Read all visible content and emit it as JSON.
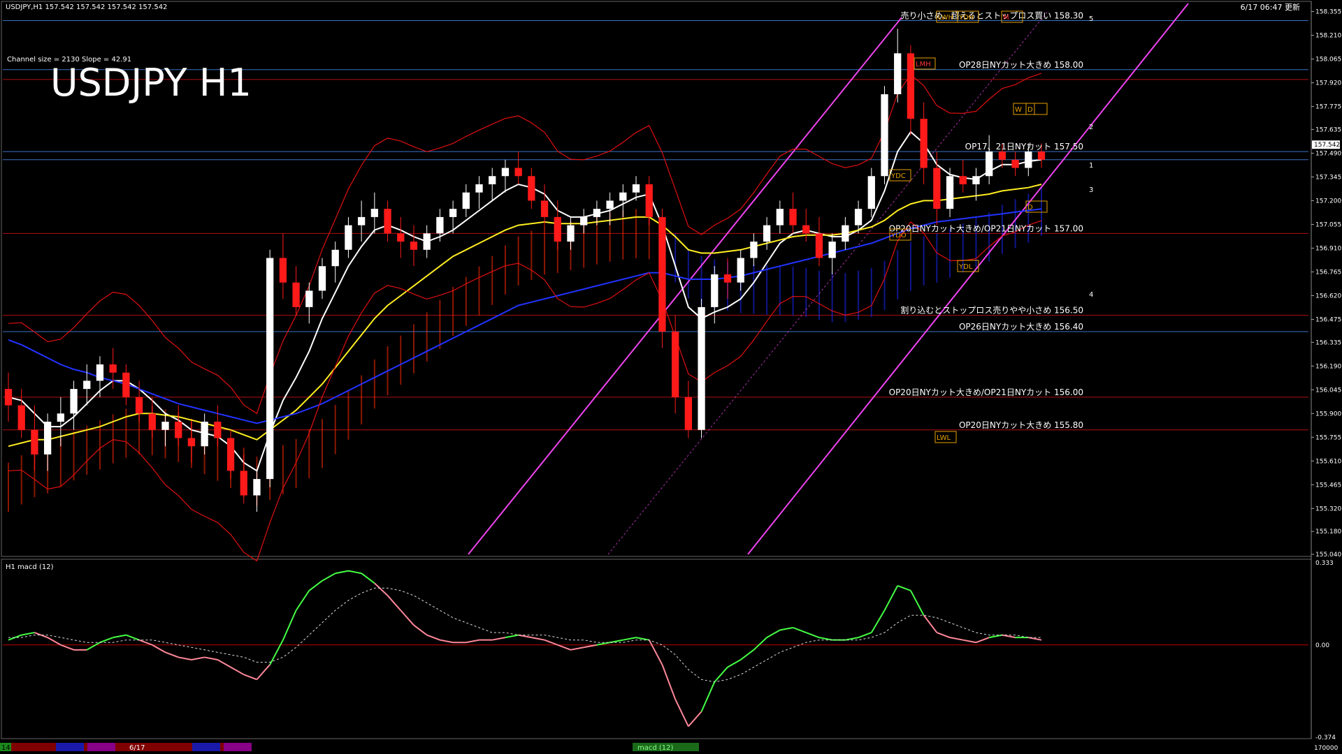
{
  "header": {
    "symbol_info": "USDJPY,H1  157.542 157.542 157.542 157.542",
    "datetime": "6/17 06:47 更新"
  },
  "channel_info": "Channel size = 2130 Slope = 42.91",
  "big_title": "USDJPY H1",
  "macd_label": "H1  macd (12)",
  "colors": {
    "background": "#000000",
    "grid_blue": "#3a74c4",
    "grid_red": "#b01010",
    "candle_up": "#ffffff",
    "candle_down": "#ff1a1a",
    "ma_white": "#ffffff",
    "ma_yellow": "#ffee22",
    "ma_blue": "#2233ff",
    "bollinger": "#e01010",
    "green_line": "#22cc22",
    "channel": "#ee44ee",
    "cloud_red": "#ff2a00",
    "cloud_blue": "#1a2aff",
    "macd_green": "#44ff44",
    "macd_pink": "#ff8899",
    "price_box": "#ffffff"
  },
  "annotations": [
    {
      "text": "売り小さめ、超えるとストップロス買い 158.30",
      "price": 158.3
    },
    {
      "text": "OP28日NYカット大きめ 158.00",
      "price": 158.0
    },
    {
      "text": "OP17、21日NYカット 157.50",
      "price": 157.5
    },
    {
      "text": "OP20日NYカット大きめ/OP21日NYカット 157.00",
      "price": 157.0
    },
    {
      "text": "割り込むとストップロス売りやや小さめ 156.50",
      "price": 156.5
    },
    {
      "text": "OP26日NYカット大きめ 156.40",
      "price": 156.4
    },
    {
      "text": "OP20日NYカット大きめ/OP21日NYカット 156.00",
      "price": 156.0
    },
    {
      "text": "OP20日NYカット大きめ 155.80",
      "price": 155.8
    }
  ],
  "box_labels": [
    "LWH",
    "YDH",
    "M",
    "LMH",
    "W",
    "D",
    "YDC",
    "YDO",
    "D",
    "YDL",
    "LWL"
  ],
  "channel_labels": [
    "5",
    "2",
    "1",
    "3",
    "4"
  ],
  "bottom_bar": {
    "left_label": "14",
    "date_label": "6/17",
    "center_label": "macd (12)",
    "right_label": "170000"
  },
  "chart_data": {
    "type": "candlestick",
    "title": "USDJPY H1",
    "y_axis": {
      "ticks": [
        158.355,
        158.21,
        158.065,
        157.92,
        157.775,
        157.635,
        157.49,
        157.345,
        157.2,
        157.055,
        156.91,
        156.765,
        156.62,
        156.475,
        156.335,
        156.19,
        156.045,
        155.9,
        155.755,
        155.61,
        155.465,
        155.32,
        155.18,
        155.04
      ],
      "ylim": [
        155.04,
        158.4
      ],
      "current_price": 157.542
    },
    "macd_axis": {
      "ticks": [
        0.333,
        0.0,
        -0.374
      ],
      "ylim": [
        -0.374,
        0.333
      ]
    },
    "horizontal_levels": {
      "blue": [
        158.3,
        158.0,
        157.5,
        157.45,
        156.4
      ],
      "red": [
        157.94,
        157.0,
        156.5,
        156.0,
        155.8
      ]
    },
    "ohlc": [
      [
        156.05,
        156.15,
        155.85,
        155.95
      ],
      [
        155.95,
        156.05,
        155.75,
        155.8
      ],
      [
        155.8,
        155.95,
        155.55,
        155.65
      ],
      [
        155.65,
        155.9,
        155.55,
        155.85
      ],
      [
        155.85,
        156.0,
        155.7,
        155.9
      ],
      [
        155.9,
        156.1,
        155.8,
        156.05
      ],
      [
        156.05,
        156.2,
        155.95,
        156.1
      ],
      [
        156.1,
        156.25,
        156.0,
        156.2
      ],
      [
        156.2,
        156.3,
        156.05,
        156.15
      ],
      [
        156.15,
        156.2,
        155.95,
        156.0
      ],
      [
        156.0,
        156.1,
        155.85,
        155.9
      ],
      [
        155.9,
        156.0,
        155.75,
        155.8
      ],
      [
        155.8,
        155.9,
        155.7,
        155.85
      ],
      [
        155.85,
        155.95,
        155.7,
        155.75
      ],
      [
        155.75,
        155.85,
        155.6,
        155.7
      ],
      [
        155.7,
        155.9,
        155.65,
        155.85
      ],
      [
        155.85,
        155.95,
        155.7,
        155.75
      ],
      [
        155.75,
        155.8,
        155.5,
        155.55
      ],
      [
        155.55,
        155.65,
        155.35,
        155.4
      ],
      [
        155.4,
        155.55,
        155.3,
        155.5
      ],
      [
        155.5,
        156.9,
        155.45,
        156.85
      ],
      [
        156.85,
        157.0,
        156.6,
        156.7
      ],
      [
        156.7,
        156.8,
        156.5,
        156.55
      ],
      [
        156.55,
        156.7,
        156.45,
        156.65
      ],
      [
        156.65,
        156.85,
        156.6,
        156.8
      ],
      [
        156.8,
        156.95,
        156.7,
        156.9
      ],
      [
        156.9,
        157.1,
        156.85,
        157.05
      ],
      [
        157.05,
        157.2,
        156.95,
        157.1
      ],
      [
        157.1,
        157.25,
        157.0,
        157.15
      ],
      [
        157.15,
        157.2,
        156.95,
        157.0
      ],
      [
        157.0,
        157.1,
        156.85,
        156.95
      ],
      [
        156.95,
        157.05,
        156.8,
        156.9
      ],
      [
        156.9,
        157.05,
        156.85,
        157.0
      ],
      [
        157.0,
        157.15,
        156.95,
        157.1
      ],
      [
        157.1,
        157.2,
        157.0,
        157.15
      ],
      [
        157.15,
        157.3,
        157.1,
        157.25
      ],
      [
        157.25,
        157.35,
        157.15,
        157.3
      ],
      [
        157.3,
        157.4,
        157.2,
        157.35
      ],
      [
        157.35,
        157.45,
        157.25,
        157.4
      ],
      [
        157.4,
        157.5,
        157.3,
        157.35
      ],
      [
        157.35,
        157.4,
        157.15,
        157.2
      ],
      [
        157.2,
        157.3,
        157.05,
        157.1
      ],
      [
        157.1,
        157.2,
        156.9,
        156.95
      ],
      [
        156.95,
        157.1,
        156.9,
        157.05
      ],
      [
        157.05,
        157.15,
        157.0,
        157.1
      ],
      [
        157.1,
        157.2,
        157.05,
        157.15
      ],
      [
        157.15,
        157.25,
        157.05,
        157.2
      ],
      [
        157.2,
        157.3,
        157.1,
        157.25
      ],
      [
        157.25,
        157.35,
        157.2,
        157.3
      ],
      [
        157.3,
        157.35,
        157.05,
        157.1
      ],
      [
        157.1,
        157.15,
        156.3,
        156.4
      ],
      [
        156.4,
        156.5,
        155.9,
        156.0
      ],
      [
        156.0,
        156.1,
        155.75,
        155.8
      ],
      [
        155.8,
        156.6,
        155.75,
        156.55
      ],
      [
        156.55,
        156.8,
        156.45,
        156.75
      ],
      [
        156.75,
        156.85,
        156.6,
        156.7
      ],
      [
        156.7,
        156.9,
        156.65,
        156.85
      ],
      [
        156.85,
        157.0,
        156.8,
        156.95
      ],
      [
        156.95,
        157.1,
        156.9,
        157.05
      ],
      [
        157.05,
        157.2,
        157.0,
        157.15
      ],
      [
        157.15,
        157.25,
        157.0,
        157.05
      ],
      [
        157.05,
        157.15,
        156.95,
        157.0
      ],
      [
        157.0,
        157.1,
        156.8,
        156.85
      ],
      [
        156.85,
        157.0,
        156.75,
        156.95
      ],
      [
        156.95,
        157.1,
        156.9,
        157.05
      ],
      [
        157.05,
        157.2,
        157.0,
        157.15
      ],
      [
        157.15,
        157.4,
        157.1,
        157.35
      ],
      [
        157.35,
        157.9,
        157.3,
        157.85
      ],
      [
        157.85,
        158.25,
        157.8,
        158.1
      ],
      [
        158.1,
        158.15,
        157.6,
        157.7
      ],
      [
        157.7,
        157.8,
        157.3,
        157.4
      ],
      [
        157.4,
        157.5,
        157.05,
        157.15
      ],
      [
        157.15,
        157.4,
        157.1,
        157.35
      ],
      [
        157.35,
        157.45,
        157.25,
        157.3
      ],
      [
        157.3,
        157.4,
        157.2,
        157.35
      ],
      [
        157.35,
        157.6,
        157.3,
        157.5
      ],
      [
        157.5,
        157.55,
        157.4,
        157.45
      ],
      [
        157.45,
        157.5,
        157.35,
        157.4
      ],
      [
        157.4,
        157.55,
        157.35,
        157.5
      ],
      [
        157.5,
        157.55,
        157.4,
        157.45
      ]
    ],
    "series": [
      {
        "name": "white-ma",
        "values": [
          156.0,
          155.98,
          155.9,
          155.82,
          155.82,
          155.88,
          155.96,
          156.04,
          156.1,
          156.1,
          156.05,
          155.98,
          155.9,
          155.86,
          155.8,
          155.78,
          155.76,
          155.7,
          155.6,
          155.55,
          155.78,
          155.98,
          156.12,
          156.28,
          156.48,
          156.64,
          156.8,
          156.92,
          157.02,
          157.05,
          157.02,
          156.98,
          156.95,
          156.98,
          157.02,
          157.08,
          157.14,
          157.2,
          157.26,
          157.3,
          157.28,
          157.24,
          157.14,
          157.1,
          157.1,
          157.12,
          157.14,
          157.18,
          157.22,
          157.24,
          157.05,
          156.8,
          156.55,
          156.48,
          156.52,
          156.55,
          156.6,
          156.7,
          156.82,
          156.94,
          157.0,
          157.02,
          157.0,
          156.98,
          156.98,
          157.02,
          157.08,
          157.26,
          157.5,
          157.62,
          157.55,
          157.42,
          157.36,
          157.34,
          157.33,
          157.38,
          157.42,
          157.42,
          157.44,
          157.45
        ]
      },
      {
        "name": "yellow-ma",
        "values": [
          155.7,
          155.72,
          155.74,
          155.74,
          155.76,
          155.78,
          155.8,
          155.82,
          155.85,
          155.88,
          155.9,
          155.9,
          155.89,
          155.88,
          155.86,
          155.84,
          155.82,
          155.8,
          155.77,
          155.74,
          155.8,
          155.86,
          155.92,
          156.0,
          156.08,
          156.18,
          156.28,
          156.38,
          156.48,
          156.56,
          156.62,
          156.68,
          156.74,
          156.8,
          156.86,
          156.9,
          156.94,
          156.98,
          157.02,
          157.05,
          157.06,
          157.07,
          157.06,
          157.06,
          157.06,
          157.07,
          157.08,
          157.09,
          157.1,
          157.1,
          157.05,
          156.98,
          156.9,
          156.88,
          156.88,
          156.89,
          156.9,
          156.92,
          156.94,
          156.96,
          156.98,
          156.99,
          156.99,
          156.99,
          157.0,
          157.02,
          157.04,
          157.08,
          157.14,
          157.18,
          157.2,
          157.2,
          157.21,
          157.22,
          157.23,
          157.24,
          157.26,
          157.27,
          157.28,
          157.3
        ]
      },
      {
        "name": "blue-ma",
        "values": [
          156.35,
          156.32,
          156.28,
          156.24,
          156.2,
          156.17,
          156.15,
          156.12,
          156.1,
          156.08,
          156.05,
          156.02,
          155.99,
          155.96,
          155.94,
          155.92,
          155.9,
          155.88,
          155.86,
          155.84,
          155.86,
          155.88,
          155.9,
          155.93,
          155.96,
          156.0,
          156.04,
          156.08,
          156.12,
          156.16,
          156.2,
          156.24,
          156.28,
          156.32,
          156.36,
          156.4,
          156.44,
          156.48,
          156.52,
          156.56,
          156.58,
          156.6,
          156.62,
          156.64,
          156.66,
          156.68,
          156.7,
          156.72,
          156.74,
          156.76,
          156.76,
          156.74,
          156.72,
          156.72,
          156.72,
          156.73,
          156.74,
          156.76,
          156.78,
          156.8,
          156.82,
          156.84,
          156.86,
          156.88,
          156.9,
          156.92,
          156.94,
          156.97,
          157.0,
          157.03,
          157.05,
          157.07,
          157.08,
          157.09,
          157.1,
          157.11,
          157.12,
          157.13,
          157.14,
          157.15
        ]
      }
    ],
    "macd": {
      "line": [
        0.02,
        0.04,
        0.05,
        0.03,
        0.0,
        -0.02,
        -0.02,
        0.01,
        0.03,
        0.04,
        0.02,
        0.0,
        -0.03,
        -0.05,
        -0.06,
        -0.05,
        -0.06,
        -0.09,
        -0.12,
        -0.14,
        -0.08,
        0.02,
        0.14,
        0.22,
        0.26,
        0.29,
        0.3,
        0.29,
        0.25,
        0.2,
        0.14,
        0.08,
        0.04,
        0.02,
        0.01,
        0.01,
        0.02,
        0.02,
        0.03,
        0.04,
        0.03,
        0.02,
        0.0,
        -0.02,
        -0.01,
        0.0,
        0.01,
        0.02,
        0.03,
        0.02,
        -0.08,
        -0.22,
        -0.33,
        -0.27,
        -0.15,
        -0.09,
        -0.06,
        -0.02,
        0.03,
        0.06,
        0.07,
        0.05,
        0.03,
        0.02,
        0.02,
        0.03,
        0.05,
        0.14,
        0.24,
        0.22,
        0.12,
        0.05,
        0.03,
        0.02,
        0.01,
        0.03,
        0.04,
        0.03,
        0.03,
        0.02
      ],
      "signal": [
        0.03,
        0.03,
        0.04,
        0.04,
        0.03,
        0.02,
        0.01,
        0.01,
        0.01,
        0.02,
        0.02,
        0.02,
        0.01,
        0.0,
        -0.01,
        -0.02,
        -0.03,
        -0.04,
        -0.05,
        -0.07,
        -0.07,
        -0.05,
        -0.01,
        0.04,
        0.09,
        0.14,
        0.18,
        0.21,
        0.23,
        0.23,
        0.22,
        0.2,
        0.17,
        0.14,
        0.11,
        0.09,
        0.07,
        0.05,
        0.05,
        0.04,
        0.04,
        0.04,
        0.03,
        0.02,
        0.02,
        0.01,
        0.01,
        0.01,
        0.02,
        0.02,
        0.0,
        -0.04,
        -0.1,
        -0.14,
        -0.15,
        -0.14,
        -0.12,
        -0.09,
        -0.06,
        -0.03,
        -0.01,
        0.01,
        0.02,
        0.02,
        0.02,
        0.02,
        0.03,
        0.05,
        0.09,
        0.12,
        0.12,
        0.11,
        0.09,
        0.07,
        0.05,
        0.04,
        0.04,
        0.04,
        0.03,
        0.03
      ]
    }
  }
}
